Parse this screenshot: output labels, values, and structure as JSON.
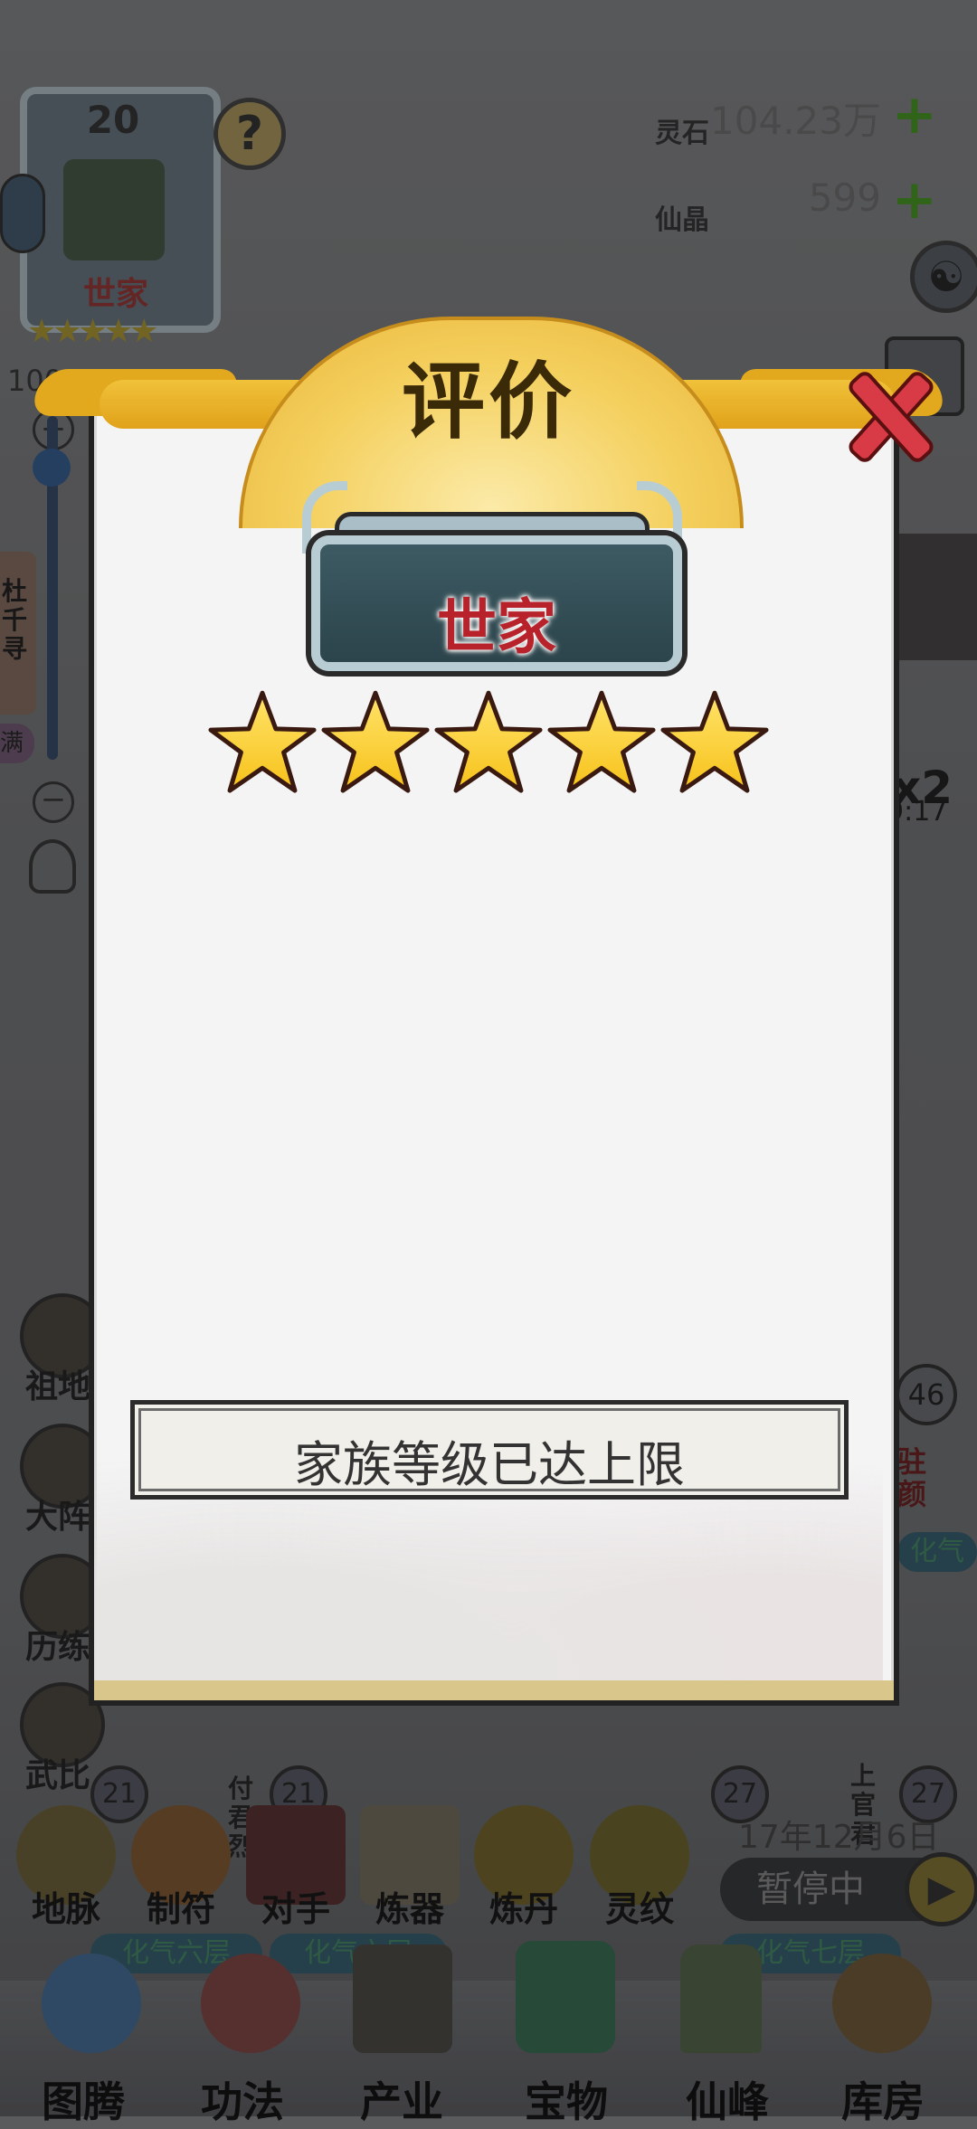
{
  "background": {
    "family_card": {
      "level": "20",
      "rank": "世家",
      "help": "?",
      "progress": "100%"
    },
    "currencies": [
      {
        "label": "灵石",
        "value": "104.23万",
        "plus": "+"
      },
      {
        "label": "仙晶",
        "value": "599",
        "plus": "+"
      }
    ],
    "zoom": {
      "plus": "+",
      "minus": "−"
    },
    "side_left_items": [
      {
        "label": "祖地"
      },
      {
        "label": "大阵"
      },
      {
        "label": "历练"
      },
      {
        "label": "武比"
      }
    ],
    "side_left_tab": "杜千寻",
    "side_left_badge": "满",
    "right_timer": {
      "multiplier": "x2",
      "time": "9:17"
    },
    "right_badge": {
      "level": "46",
      "tag": "驻颜",
      "realm": "化气"
    },
    "disciples_left": [
      {
        "level": "21",
        "name": "付君烈",
        "realm": "化气六层"
      },
      {
        "level": "21",
        "realm": "化气六层"
      }
    ],
    "disciples_right": [
      {
        "level": "27",
        "name": "上官君"
      },
      {
        "level": "27",
        "realm": "化气七层"
      }
    ],
    "date": "17年12月6日",
    "pause_label": "暂停中",
    "toolbar": [
      {
        "label": "地脉"
      },
      {
        "label": "制符"
      },
      {
        "label": "对手"
      },
      {
        "label": "炼器"
      },
      {
        "label": "炼丹"
      },
      {
        "label": "灵纹"
      }
    ],
    "bottom_nav": [
      {
        "label": "图腾"
      },
      {
        "label": "功法"
      },
      {
        "label": "产业"
      },
      {
        "label": "宝物"
      },
      {
        "label": "仙峰"
      },
      {
        "label": "库房"
      }
    ]
  },
  "dialog": {
    "title": "评价",
    "rank": "世家",
    "stars_filled": 5,
    "stars_total": 5,
    "message": "家族等级已达上限",
    "close_icon": "close-x-icon"
  },
  "colors": {
    "ribbon": "#e8b02a",
    "rank_text": "#b8232b",
    "star": "#f7c21a",
    "close": "#d83b45"
  }
}
